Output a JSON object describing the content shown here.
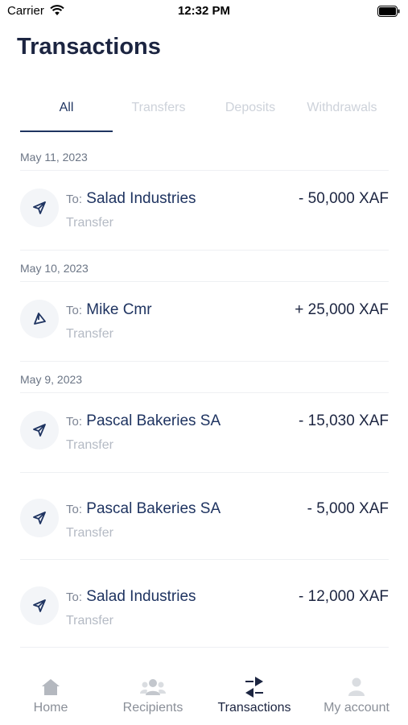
{
  "status_bar": {
    "carrier": "Carrier",
    "time": "12:32 PM"
  },
  "header": {
    "title": "Transactions"
  },
  "tabs": [
    {
      "label": "All",
      "active": true
    },
    {
      "label": "Transfers",
      "active": false
    },
    {
      "label": "Deposits",
      "active": false
    },
    {
      "label": "Withdrawals",
      "active": false
    }
  ],
  "groups": [
    {
      "date": "May 11, 2023",
      "transactions": [
        {
          "to_prefix": "To:",
          "recipient": "Salad Industries",
          "type": "Transfer",
          "amount": "- 50,000 XAF",
          "icon": "send-icon"
        }
      ]
    },
    {
      "date": "May 10, 2023",
      "transactions": [
        {
          "to_prefix": "To:",
          "recipient": "Mike Cmr",
          "type": "Transfer",
          "amount": "+ 25,000 XAF",
          "icon": "receive-icon"
        }
      ]
    },
    {
      "date": "May 9, 2023",
      "transactions": [
        {
          "to_prefix": "To:",
          "recipient": "Pascal Bakeries SA",
          "type": "Transfer",
          "amount": "- 15,030 XAF",
          "icon": "send-icon"
        },
        {
          "to_prefix": "To:",
          "recipient": "Pascal Bakeries SA",
          "type": "Transfer",
          "amount": "- 5,000 XAF",
          "icon": "send-icon"
        },
        {
          "to_prefix": "To:",
          "recipient": "Salad Industries",
          "type": "Transfer",
          "amount": "- 12,000 XAF",
          "icon": "send-icon"
        }
      ]
    }
  ],
  "tab_bar": [
    {
      "label": "Home",
      "icon": "home-icon",
      "active": false
    },
    {
      "label": "Recipients",
      "icon": "recipients-icon",
      "active": false
    },
    {
      "label": "Transactions",
      "icon": "transactions-icon",
      "active": true
    },
    {
      "label": "My account",
      "icon": "account-icon",
      "active": false
    }
  ],
  "colors": {
    "primary": "#1f3461",
    "inactive": "#cdd2da",
    "muted": "#b4bac4"
  }
}
